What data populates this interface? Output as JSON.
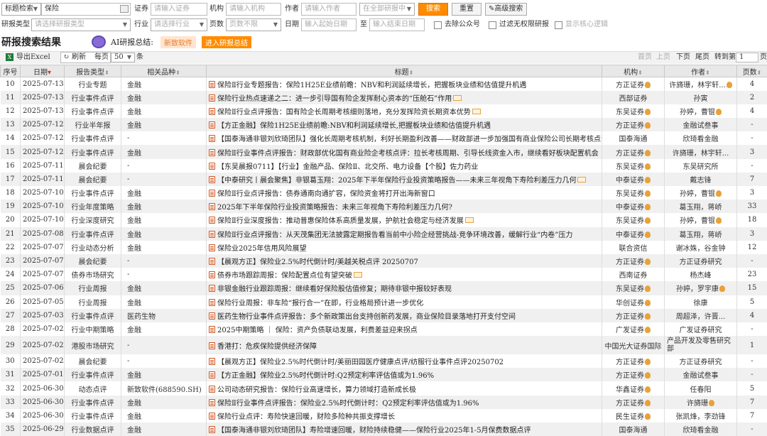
{
  "filters": {
    "search_type": "标题检索",
    "keyword": "保险",
    "sec_label": "证券",
    "sec_ph": "请输入证券",
    "org_label": "机构",
    "org_ph": "请输入机构",
    "author_label": "作者",
    "author_ph": "请输入作者",
    "scope": "在全部研报中",
    "search_btn": "搜索",
    "reset_btn": "重置",
    "adv_btn": "高级搜索",
    "rtype_label": "研报类型",
    "rtype_ph": "请选择研报类型",
    "ind_label": "行业",
    "ind_ph": "请选择行业",
    "pages_label": "页数",
    "pages_val": "页数不限",
    "date_label": "日期",
    "date_start_ph": "输入起始日期",
    "date_to": "至",
    "date_end_ph": "输入结束日期",
    "cb1": "去除公众号",
    "cb2": "过滤无权限研报",
    "cb3": "显示核心逻辑"
  },
  "results": {
    "heading": "研报搜索结果",
    "ai_label": "AI研报总结:",
    "ai_tag": "新致软件",
    "ai_btn": "进入研报总结"
  },
  "toolbar": {
    "export": "导出Excel",
    "refresh": "刷新",
    "per_page_label": "每页",
    "per_page": "50",
    "per_page_unit": "条",
    "first": "首页",
    "prev": "上页",
    "next": "下页",
    "last": "尾页",
    "goto": "转到第",
    "page": "1",
    "page_unit": "页"
  },
  "columns": [
    "序号",
    "日期",
    "报告类型",
    "相关品种",
    "标题",
    "机构",
    "作者",
    "页数"
  ],
  "rows": [
    [
      "10",
      "2025-07-13",
      "行业专题",
      "金融",
      "保险Ⅱ行业专题报告：保险1H25E业绩前瞻：NBV和利润延续增长，把握板块业绩和估值提升机遇",
      "方正证券",
      "许旖珊，林宇轩...",
      "4"
    ],
    [
      "11",
      "2025-07-13",
      "行业事件点评",
      "金融",
      "保险行业热点速递之二：进一步引导国有险企发挥耐心资本的“压舱石”作用",
      "西部证券",
      "孙寅",
      "2"
    ],
    [
      "12",
      "2025-07-13",
      "行业事件点评",
      "金融",
      "保险Ⅱ行业点评报告：国有险企长周期考核细则落地，充分发挥险资长期资本优势",
      "东吴证券",
      "孙婷，曹锟",
      "4"
    ],
    [
      "13",
      "2025-07-12",
      "行业半年报",
      "金融",
      "【方正金融】保险1H25E业绩前瞻:NBV和利润延续增长,把握板块业绩和估值提升机遇",
      "方正证券",
      "金融试叁事",
      "-"
    ],
    [
      "14",
      "2025-07-12",
      "行业事件点评",
      "-",
      "【国泰海通非银刘欣琦团队】强化长周期考核机制，利好长期盈利改善——财政部进一步加强国有商业保险公司长期考核点评",
      "国泰海通",
      "欣琦看金融",
      "-"
    ],
    [
      "15",
      "2025-07-12",
      "行业事件点评",
      "金融",
      "保险Ⅱ行业事件点评报告：财政部优化国有商业险企考核点评：拉长考核周期、引导长线资金入市，继续看好板块配置机会",
      "方正证券",
      "许旖珊，林宇轩...",
      "3"
    ],
    [
      "16",
      "2025-07-11",
      "晨会纪要",
      "-",
      "【东吴晨报0711】【行业】金融产品、保险Ⅱ、北交所、电力设备【个股】佐力药业",
      "东吴证券",
      "东吴研究所",
      "-"
    ],
    [
      "17",
      "2025-07-11",
      "晨会纪要",
      "-",
      "【中泰研究丨晨会聚焦】非银葛玉翔：2025年下半年保险行业投资策略报告——未来三年视角下寿险利差压力几何",
      "中泰证券",
      "戴志锋",
      "7"
    ],
    [
      "18",
      "2025-07-10",
      "行业事件点评",
      "金融",
      "保险Ⅱ行业点评报告：债券通南向通扩容，保险资金将打开出海新窗口",
      "东吴证券",
      "孙婷，曹锟",
      "3"
    ],
    [
      "19",
      "2025-07-10",
      "行业年度策略",
      "金融",
      "2025年下半年保险行业投资策略报告：未来三年视角下寿险利差压力几何?",
      "中泰证券",
      "葛玉翔，蒋峤",
      "33"
    ],
    [
      "20",
      "2025-07-10",
      "行业深度研究",
      "金融",
      "保险Ⅱ行业深度报告：推动普惠保险体系高质量发展，护航社会稳定与经济发展",
      "东吴证券",
      "孙婷，曹锟",
      "18"
    ],
    [
      "21",
      "2025-07-08",
      "行业事件点评",
      "金融",
      "保险Ⅱ行业点评报告：从天茂集团无法披露定期报告看当前中小险企经营挑战-竞争环境改善，缓解行业“内卷”压力",
      "中泰证券",
      "葛玉翔，蒋峤",
      "3"
    ],
    [
      "22",
      "2025-07-07",
      "行业动态分析",
      "金融",
      "保险业2025年信用风险展望",
      "联合资信",
      "谢冰姝，谷金钟",
      "12"
    ],
    [
      "23",
      "2025-07-07",
      "晨会纪要",
      "-",
      "【晨观方正】保险业2.5%时代倒计时/美越关税点评 20250707",
      "方正证券",
      "方正证券研究",
      "-"
    ],
    [
      "24",
      "2025-07-07",
      "债券市场研究",
      "-",
      "债券市场跟踪周报：保险配置点位有望突破",
      "西南证券",
      "杨杰峰",
      "23"
    ],
    [
      "25",
      "2025-07-06",
      "行业周报",
      "金融",
      "非银金融行业跟踪周报：继续看好保险股估值修复；期待非银中报较好表现",
      "东吴证券",
      "孙婷，罗宇康",
      "15"
    ],
    [
      "26",
      "2025-07-05",
      "行业周报",
      "金融",
      "保险行业周报：非车险“报行合一”在即，行业格局预计进一步优化",
      "华创证券",
      "徐康",
      "5"
    ],
    [
      "27",
      "2025-07-03",
      "行业事件点评",
      "医药生物",
      "医药生物行业事件点评报告：多个新政策出台支持创新药发展，商业保险目录落地打开支付空间",
      "方正证券",
      "周超泽，许晋...",
      "4"
    ],
    [
      "28",
      "2025-07-02",
      "行业中期策略",
      "金融",
      "2025中期策略 ｜ 保险：资产负债联动发展，利费差益迎来拐点",
      "广发证券",
      "广发证券研究",
      "-"
    ],
    [
      "29",
      "2025-07-02",
      "港股市场研究",
      "-",
      "香港打：危疾保险提供经济保障",
      "中国光大证券国际",
      "产品开发及零售研究部",
      "1"
    ],
    [
      "30",
      "2025-07-02",
      "晨会纪要",
      "-",
      "【晨观方正】保险业2.5%时代倒计时/美丽田园医疗健康点评/纺服行业事件点评20250702",
      "方正证券",
      "方正证券研究",
      "-"
    ],
    [
      "31",
      "2025-07-01",
      "行业事件点评",
      "金融",
      "【方正金融】保险业2.5%时代倒计时:Q2预定利率评估值或为1.96%",
      "方正证券",
      "金融试叁事",
      "-"
    ],
    [
      "32",
      "2025-06-30",
      "动态点评",
      "新致软件(688590.SH)",
      "公司动态研究报告：保险行业高速增长，算力领域打造新成长极",
      "华鑫证券",
      "任春阳",
      "5"
    ],
    [
      "33",
      "2025-06-30",
      "行业事件点评",
      "金融",
      "保险Ⅱ行业事件点评报告：保险业2.5%时代倒计时：Q2预定利率评估值或为1.96%",
      "方正证券",
      "许旖珊",
      "7"
    ],
    [
      "34",
      "2025-06-30",
      "行业事件点评",
      "金融",
      "保险行业点评：寿险快速回暖，财险多险种共振支撑增长",
      "民生证券",
      "张凯烽，李劲锋",
      "7"
    ],
    [
      "35",
      "2025-06-29",
      "行业数据点评",
      "金融",
      "【国泰海通非银刘欣琦团队】寿险增速回暖，财险持续稳健——保险行业2025年1-5月保费数据点评",
      "国泰海通",
      "欣琦看金融",
      "-"
    ]
  ]
}
